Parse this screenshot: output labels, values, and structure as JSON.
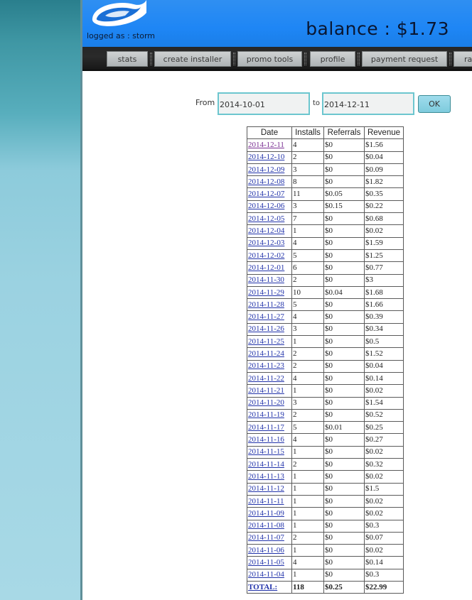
{
  "header": {
    "logged_as": "logged as : storm",
    "balance": "balance : $1.73"
  },
  "nav": {
    "items": [
      "stats",
      "create installer",
      "promo tools",
      "profile",
      "payment request",
      "ra"
    ]
  },
  "filter": {
    "from_label": "From",
    "from_value": "2014-10-01",
    "to_label": "to",
    "to_value": "2014-12-11",
    "ok_label": "OK"
  },
  "table": {
    "headers": [
      "Date",
      "Installs",
      "Referrals",
      "Revenue"
    ],
    "rows": [
      [
        "2014-12-11",
        "4",
        "$0",
        "$1.56"
      ],
      [
        "2014-12-10",
        "2",
        "$0",
        "$0.04"
      ],
      [
        "2014-12-09",
        "3",
        "$0",
        "$0.09"
      ],
      [
        "2014-12-08",
        "8",
        "$0",
        "$1.82"
      ],
      [
        "2014-12-07",
        "11",
        "$0.05",
        "$0.35"
      ],
      [
        "2014-12-06",
        "3",
        "$0.15",
        "$0.22"
      ],
      [
        "2014-12-05",
        "7",
        "$0",
        "$0.68"
      ],
      [
        "2014-12-04",
        "1",
        "$0",
        "$0.02"
      ],
      [
        "2014-12-03",
        "4",
        "$0",
        "$1.59"
      ],
      [
        "2014-12-02",
        "5",
        "$0",
        "$1.25"
      ],
      [
        "2014-12-01",
        "6",
        "$0",
        "$0.77"
      ],
      [
        "2014-11-30",
        "2",
        "$0",
        "$3"
      ],
      [
        "2014-11-29",
        "10",
        "$0.04",
        "$1.68"
      ],
      [
        "2014-11-28",
        "5",
        "$0",
        "$1.66"
      ],
      [
        "2014-11-27",
        "4",
        "$0",
        "$0.39"
      ],
      [
        "2014-11-26",
        "3",
        "$0",
        "$0.34"
      ],
      [
        "2014-11-25",
        "1",
        "$0",
        "$0.5"
      ],
      [
        "2014-11-24",
        "2",
        "$0",
        "$1.52"
      ],
      [
        "2014-11-23",
        "2",
        "$0",
        "$0.04"
      ],
      [
        "2014-11-22",
        "4",
        "$0",
        "$0.14"
      ],
      [
        "2014-11-21",
        "1",
        "$0",
        "$0.02"
      ],
      [
        "2014-11-20",
        "3",
        "$0",
        "$1.54"
      ],
      [
        "2014-11-19",
        "2",
        "$0",
        "$0.52"
      ],
      [
        "2014-11-17",
        "5",
        "$0.01",
        "$0.25"
      ],
      [
        "2014-11-16",
        "4",
        "$0",
        "$0.27"
      ],
      [
        "2014-11-15",
        "1",
        "$0",
        "$0.02"
      ],
      [
        "2014-11-14",
        "2",
        "$0",
        "$0.32"
      ],
      [
        "2014-11-13",
        "1",
        "$0",
        "$0.02"
      ],
      [
        "2014-11-12",
        "1",
        "$0",
        "$1.5"
      ],
      [
        "2014-11-11",
        "1",
        "$0",
        "$0.02"
      ],
      [
        "2014-11-09",
        "1",
        "$0",
        "$0.02"
      ],
      [
        "2014-11-08",
        "1",
        "$0",
        "$0.3"
      ],
      [
        "2014-11-07",
        "2",
        "$0",
        "$0.07"
      ],
      [
        "2014-11-06",
        "1",
        "$0",
        "$0.02"
      ],
      [
        "2014-11-05",
        "4",
        "$0",
        "$0.14"
      ],
      [
        "2014-11-04",
        "1",
        "$0",
        "$0.3"
      ]
    ],
    "total": [
      "TOTAL:",
      "118",
      "$0.25",
      "$22.99"
    ]
  },
  "icons": {
    "logo": "swoosh-logo-icon"
  },
  "colors": {
    "header_blue": "#1e86f5",
    "navbar_dark": "#222222",
    "input_border": "#6cc6cf",
    "ok_button": "#8fd3e4",
    "link": "#2233aa",
    "visited_link": "#7a2f93"
  }
}
